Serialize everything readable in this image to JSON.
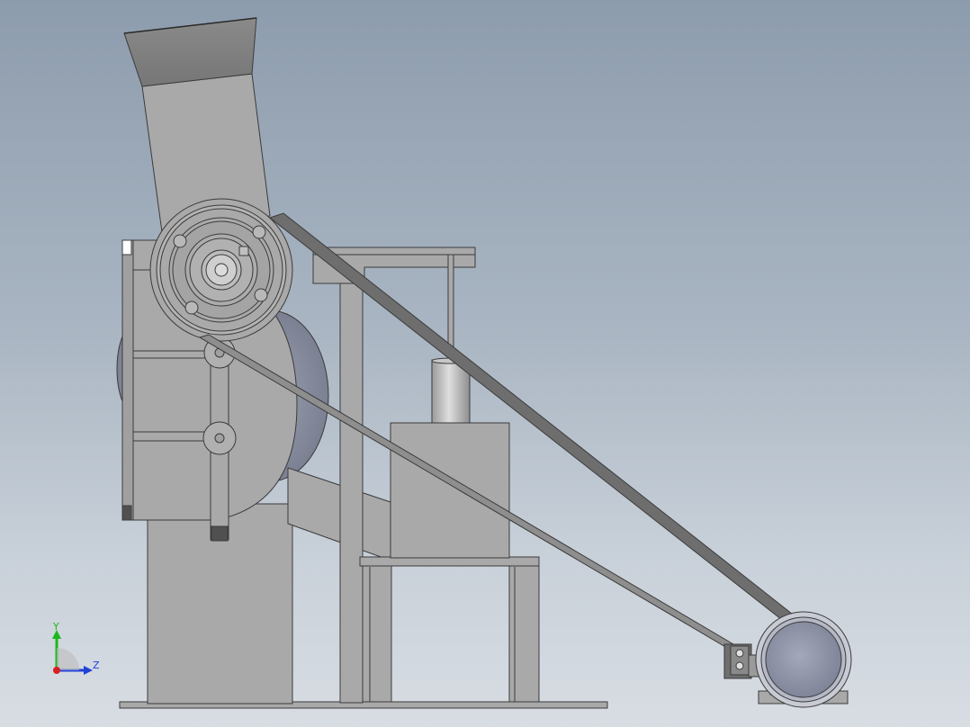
{
  "triad": {
    "y_label": "Y",
    "z_label": "Z"
  },
  "colors": {
    "body": "#a9a9a9",
    "body_light": "#b4b4b4",
    "edge": "#3b3b3b",
    "dark": "#595959",
    "motor_face": "#9aa0b3",
    "motor_body": "#b7bcc8",
    "cylinder_light": "#d2d2d2",
    "belt": "#5a5a5a",
    "axis_y": "#1bb81b",
    "axis_z": "#2040d8",
    "axis_x": "#d82020"
  }
}
